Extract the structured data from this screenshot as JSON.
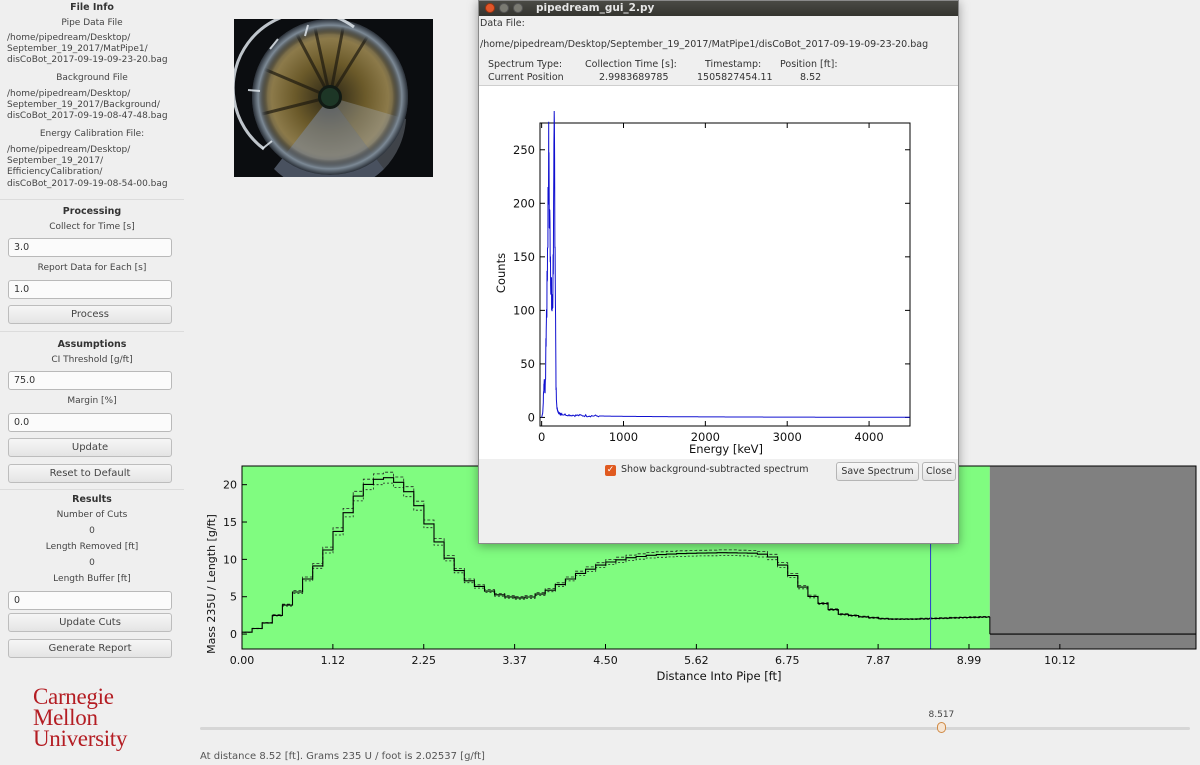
{
  "sidebar": {
    "file_info": {
      "title": "File Info",
      "pipe_label": "Pipe Data File",
      "pipe_path": "/home/pipedream/Desktop/\nSeptember_19_2017/MatPipe1/\ndisCoBot_2017-09-19-09-23-20.bag",
      "background_label": "Background File",
      "background_path": "/home/pipedream/Desktop/\nSeptember_19_2017/Background/\ndisCoBot_2017-09-19-08-47-48.bag",
      "energy_label": "Energy Calibration File:",
      "energy_path": "/home/pipedream/Desktop/\nSeptember_19_2017/\nEfficiencyCalibration/\ndisCoBot_2017-09-19-08-54-00.bag"
    },
    "processing": {
      "title": "Processing",
      "collect_label": "Collect for Time [s]",
      "collect_value": "3.0",
      "report_label": "Report Data for Each [s]",
      "report_value": "1.0",
      "process_button": "Process"
    },
    "assumptions": {
      "title": "Assumptions",
      "threshold_label": "CI Threshold [g/ft]",
      "threshold_value": "75.0",
      "margin_label": "Margin [%]",
      "margin_value": "0.0",
      "update_button": "Update",
      "reset_button": "Reset to Default"
    },
    "results": {
      "title": "Results",
      "cuts_label": "Number of Cuts",
      "cuts_value": "0",
      "removed_label": "Length Removed [ft]",
      "removed_value": "0",
      "buffer_label": "Length Buffer [ft]",
      "buffer_value": "0",
      "update_cuts_button": "Update Cuts",
      "report_button": "Generate Report"
    },
    "logo": {
      "line1": "Carnegie",
      "line2": "Mellon",
      "line3": "University"
    }
  },
  "slider": {
    "value_label": "8.517",
    "fraction": 0.748
  },
  "status_text": "At distance  8.52 [ft]. Grams 235 U / foot is  2.02537 [g/ft]",
  "dialog": {
    "title": "pipedream_gui_2.py",
    "data_file_label": "Data File:",
    "data_file_path": "/home/pipedream/Desktop/September_19_2017/MatPipe1/disCoBot_2017-09-19-09-23-20.bag",
    "headers": [
      "Spectrum Type:",
      "Collection Time [s]:",
      "Timestamp:",
      "Position [ft]:"
    ],
    "values": [
      "Current Position",
      "2.9983689785",
      "1505827454.11",
      "8.52"
    ],
    "checkbox_label": "Show background-subtracted spectrum",
    "checkbox_checked": true,
    "save_button": "Save Spectrum",
    "close_button": "Close"
  },
  "colors": {
    "plot_green": "#80fc80",
    "plot_gray": "#808080",
    "spectrum_blue": "#1010d0",
    "position_line": "#2a3cd0",
    "cmu_red": "#b41d23"
  },
  "chart_data": [
    {
      "type": "line",
      "ylabel": "Counts",
      "xlabel": "Energy [keV]",
      "xlim": [
        -20,
        4500
      ],
      "ylim": [
        -8,
        275
      ],
      "xticks": [
        0,
        1000,
        2000,
        3000,
        4000
      ],
      "yticks": [
        0,
        50,
        100,
        150,
        200,
        250
      ],
      "x": [
        0,
        15,
        30,
        45,
        55,
        65,
        75,
        85,
        95,
        105,
        115,
        125,
        135,
        145,
        155,
        165,
        175,
        185,
        195,
        210,
        240,
        300,
        400,
        600,
        1000,
        2000,
        3000,
        4000,
        4500
      ],
      "values": [
        0,
        5,
        35,
        25,
        80,
        110,
        175,
        245,
        190,
        165,
        125,
        100,
        105,
        175,
        262,
        160,
        30,
        10,
        6,
        4,
        3,
        2.5,
        2,
        1.5,
        1,
        0.5,
        0.3,
        0.2,
        0.2
      ]
    },
    {
      "type": "line",
      "ylabel": "Mass 235U / Length  [g/ft]",
      "xlabel": "Distance Into Pipe [ft]",
      "xlim": [
        0,
        11.8
      ],
      "ylim": [
        -2,
        22.5
      ],
      "xtick_labels": [
        "0.00",
        "1.12",
        "2.25",
        "3.37",
        "4.50",
        "5.62",
        "6.75",
        "7.87",
        "8.99",
        "10.12"
      ],
      "xticks": [
        0,
        1.124,
        2.248,
        3.372,
        4.496,
        5.62,
        6.744,
        7.868,
        8.992,
        10.116
      ],
      "yticks": [
        0,
        5,
        10,
        15,
        20
      ],
      "data_end": 9.25,
      "position_marker": 8.517,
      "x": [
        0,
        0.25,
        0.5,
        0.75,
        1.0,
        1.2,
        1.4,
        1.6,
        1.8,
        2.0,
        2.2,
        2.4,
        2.6,
        2.8,
        3.0,
        3.2,
        3.4,
        3.6,
        3.8,
        4.0,
        4.2,
        4.5,
        4.8,
        5.1,
        5.5,
        6.0,
        6.4,
        6.6,
        6.8,
        7.0,
        7.2,
        7.4,
        7.7,
        8.0,
        8.3,
        8.6,
        8.9,
        9.25
      ],
      "values": [
        0,
        1.0,
        3.0,
        6.5,
        10.0,
        14.0,
        18.0,
        20.5,
        21.0,
        20.0,
        17.0,
        13.0,
        9.5,
        7.2,
        6.0,
        5.2,
        4.8,
        5.0,
        5.8,
        7.0,
        8.2,
        9.5,
        10.2,
        10.6,
        10.8,
        10.9,
        10.8,
        10.2,
        8.0,
        5.5,
        4.0,
        2.7,
        2.3,
        2.0,
        2.0,
        2.1,
        2.2,
        2.3
      ],
      "beyond_values": 0.0
    }
  ]
}
